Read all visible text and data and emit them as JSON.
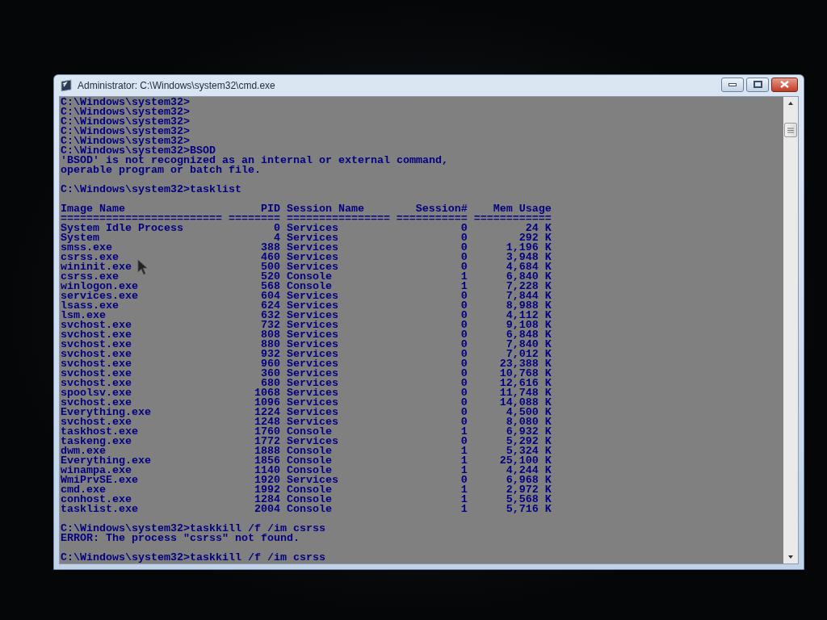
{
  "window": {
    "title": "Administrator: C:\\Windows\\system32\\cmd.exe"
  },
  "console": [
    {
      "kind": "line",
      "text": "C:\\Windows\\system32>"
    },
    {
      "kind": "line",
      "text": "C:\\Windows\\system32>"
    },
    {
      "kind": "line",
      "text": "C:\\Windows\\system32>"
    },
    {
      "kind": "line",
      "text": "C:\\Windows\\system32>"
    },
    {
      "kind": "line",
      "text": "C:\\Windows\\system32>"
    },
    {
      "kind": "line",
      "text": "C:\\Windows\\system32>BSOD"
    },
    {
      "kind": "line",
      "text": "'BSOD' is not recognized as an internal or external command,"
    },
    {
      "kind": "line",
      "text": "operable program or batch file."
    },
    {
      "kind": "blank"
    },
    {
      "kind": "line",
      "text": "C:\\Windows\\system32>tasklist"
    },
    {
      "kind": "blank"
    },
    {
      "kind": "table",
      "columns": [
        "Image Name",
        "PID",
        "Session Name",
        "Session#",
        "Mem Usage"
      ],
      "rule": [
        "=========================",
        "========",
        "================",
        "===========",
        "============"
      ],
      "rows": [
        [
          "System Idle Process",
          "0",
          "Services",
          "0",
          "24 K"
        ],
        [
          "System",
          "4",
          "Services",
          "0",
          "292 K"
        ],
        [
          "smss.exe",
          "388",
          "Services",
          "0",
          "1,196 K"
        ],
        [
          "csrss.exe",
          "460",
          "Services",
          "0",
          "3,948 K"
        ],
        [
          "wininit.exe",
          "500",
          "Services",
          "0",
          "4,684 K"
        ],
        [
          "csrss.exe",
          "520",
          "Console",
          "1",
          "6,840 K"
        ],
        [
          "winlogon.exe",
          "568",
          "Console",
          "1",
          "7,228 K"
        ],
        [
          "services.exe",
          "604",
          "Services",
          "0",
          "7,844 K"
        ],
        [
          "lsass.exe",
          "624",
          "Services",
          "0",
          "8,988 K"
        ],
        [
          "lsm.exe",
          "632",
          "Services",
          "0",
          "4,112 K"
        ],
        [
          "svchost.exe",
          "732",
          "Services",
          "0",
          "9,108 K"
        ],
        [
          "svchost.exe",
          "808",
          "Services",
          "0",
          "6,848 K"
        ],
        [
          "svchost.exe",
          "880",
          "Services",
          "0",
          "7,840 K"
        ],
        [
          "svchost.exe",
          "932",
          "Services",
          "0",
          "7,012 K"
        ],
        [
          "svchost.exe",
          "960",
          "Services",
          "0",
          "23,388 K"
        ],
        [
          "svchost.exe",
          "360",
          "Services",
          "0",
          "10,768 K"
        ],
        [
          "svchost.exe",
          "680",
          "Services",
          "0",
          "12,616 K"
        ],
        [
          "spoolsv.exe",
          "1068",
          "Services",
          "0",
          "11,748 K"
        ],
        [
          "svchost.exe",
          "1096",
          "Services",
          "0",
          "14,088 K"
        ],
        [
          "Everything.exe",
          "1224",
          "Services",
          "0",
          "4,500 K"
        ],
        [
          "svchost.exe",
          "1248",
          "Services",
          "0",
          "8,080 K"
        ],
        [
          "taskhost.exe",
          "1760",
          "Console",
          "1",
          "6,932 K"
        ],
        [
          "taskeng.exe",
          "1772",
          "Services",
          "0",
          "5,292 K"
        ],
        [
          "dwm.exe",
          "1888",
          "Console",
          "1",
          "5,324 K"
        ],
        [
          "Everything.exe",
          "1856",
          "Console",
          "1",
          "25,100 K"
        ],
        [
          "winampa.exe",
          "1140",
          "Console",
          "1",
          "4,244 K"
        ],
        [
          "WmiPrvSE.exe",
          "1920",
          "Services",
          "0",
          "6,968 K"
        ],
        [
          "cmd.exe",
          "1992",
          "Console",
          "1",
          "2,972 K"
        ],
        [
          "conhost.exe",
          "1284",
          "Console",
          "1",
          "5,568 K"
        ],
        [
          "tasklist.exe",
          "2004",
          "Console",
          "1",
          "5,716 K"
        ]
      ]
    },
    {
      "kind": "blank"
    },
    {
      "kind": "line",
      "text": "C:\\Windows\\system32>taskkill /f /im csrss"
    },
    {
      "kind": "line",
      "text": "ERROR: The process \"csrss\" not found."
    },
    {
      "kind": "blank"
    },
    {
      "kind": "line",
      "text": "C:\\Windows\\system32>taskkill /f /im csrss"
    }
  ]
}
